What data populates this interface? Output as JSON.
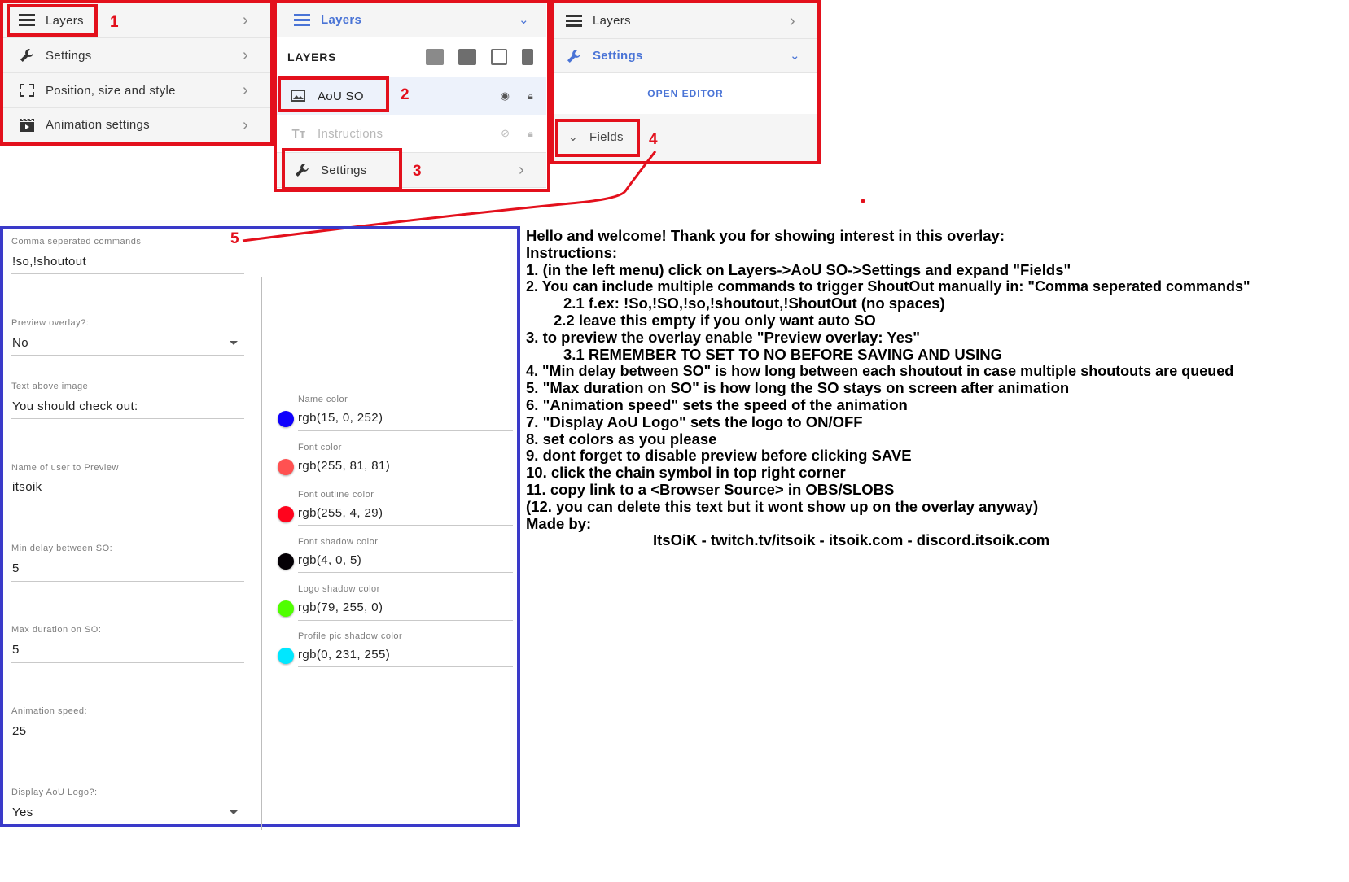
{
  "panel1": {
    "items": [
      {
        "label": "Layers",
        "icon": "hamburger-icon"
      },
      {
        "label": "Settings",
        "icon": "wrench-icon"
      },
      {
        "label": "Position, size and style",
        "icon": "dashed-square-icon"
      },
      {
        "label": "Animation settings",
        "icon": "clapperboard-icon"
      }
    ]
  },
  "panel2": {
    "header": "Layers",
    "layers_title": "LAYERS",
    "layers": [
      {
        "label": "AoU SO",
        "icon": "image-icon"
      },
      {
        "label": "Instructions",
        "icon": "text-icon"
      }
    ],
    "settings": "Settings"
  },
  "panel3": {
    "layers": "Layers",
    "settings": "Settings",
    "open_editor": "OPEN EDITOR",
    "fields": "Fields"
  },
  "callouts": [
    "1",
    "2",
    "3",
    "4",
    "5"
  ],
  "form": {
    "left": [
      {
        "label": "Comma seperated commands",
        "value": "!so,!shoutout"
      },
      {
        "label": "Preview overlay?:",
        "value": "No"
      },
      {
        "label": "Text above image",
        "value": "You should check out:"
      },
      {
        "label": "Name of user to Preview",
        "value": "itsoik"
      },
      {
        "label": "Min delay between SO:",
        "value": "5"
      },
      {
        "label": "Max duration on SO:",
        "value": "5"
      },
      {
        "label": "Animation speed:",
        "value": "25"
      },
      {
        "label": "Display AoU Logo?:",
        "value": "Yes"
      }
    ],
    "colors": [
      {
        "label": "Name color",
        "value": "rgb(15, 0, 252)",
        "color": "#0f00fc"
      },
      {
        "label": "Font color",
        "value": "rgb(255, 81, 81)",
        "color": "#ff5151"
      },
      {
        "label": "Font outline color",
        "value": "rgb(255, 4, 29)",
        "color": "#ff041d"
      },
      {
        "label": "Font shadow color",
        "value": "rgb(4, 0, 5)",
        "color": "#040005"
      },
      {
        "label": "Logo shadow color",
        "value": "rgb(79, 255, 0)",
        "color": "#4fff00"
      },
      {
        "label": "Profile pic shadow color",
        "value": "rgb(0, 231, 255)",
        "color": "#00e7ff"
      }
    ]
  },
  "instructions": [
    "Hello and welcome! Thank you for showing interest in this overlay:",
    "Instructions:",
    "1. (in the left menu) click on Layers->AoU SO->Settings and expand \"Fields\"",
    "2. You can include multiple commands to trigger ShoutOut manually in: \"Comma seperated commands\"",
    "2.1 f.ex: !So,!SO,!so,!shoutout,!ShoutOut (no spaces)",
    "2.2 leave this empty if you only want auto SO",
    "3. to preview the overlay enable \"Preview overlay: Yes\"",
    "3.1 REMEMBER TO SET TO NO BEFORE SAVING AND USING",
    "4. \"Min delay between SO\" is how long between each shoutout in case multiple shoutouts are queued",
    "5. \"Max duration on SO\" is how long the SO stays on screen after animation",
    "6. \"Animation speed\" sets the speed of the animation",
    "7. \"Display AoU Logo\" sets the logo to ON/OFF",
    "8. set colors as you please",
    "9. dont forget to disable preview before clicking SAVE",
    "10. click the chain symbol in top right corner",
    "11. copy link to a <Browser Source> in OBS/SLOBS",
    "(12. you can delete this text but it wont show up on the overlay anyway)",
    "Made by:",
    "ItsOiK - twitch.tv/itsoik - itsoik.com - discord.itsoik.com"
  ],
  "colors": {
    "accent": "#4a74d6",
    "annotation_red": "#e3101c",
    "annotation_blue": "#3a3ac9"
  }
}
